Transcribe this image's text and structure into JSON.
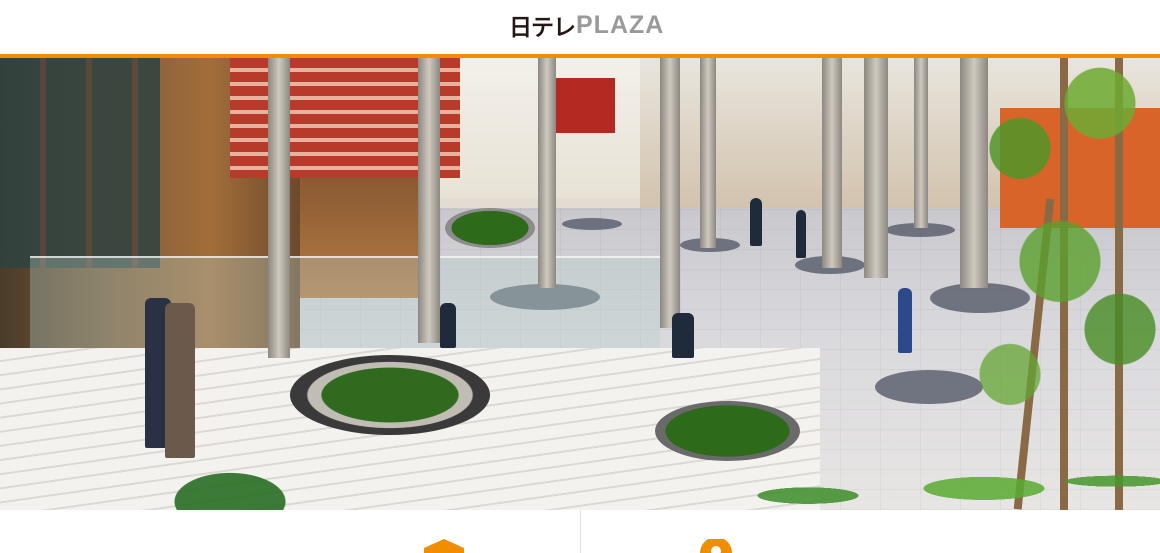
{
  "header": {
    "logo_jp": "日テレ",
    "logo_en": "PLAZA",
    "accent_color": "#f18d00"
  },
  "hero": {
    "image_name": "hero-plaza-photo"
  },
  "bottom_nav": {
    "items": [
      {
        "icon": "building-roof-icon",
        "color": "#f18d00"
      },
      {
        "icon": "map-pin-icon",
        "color": "#f18d00"
      }
    ]
  }
}
